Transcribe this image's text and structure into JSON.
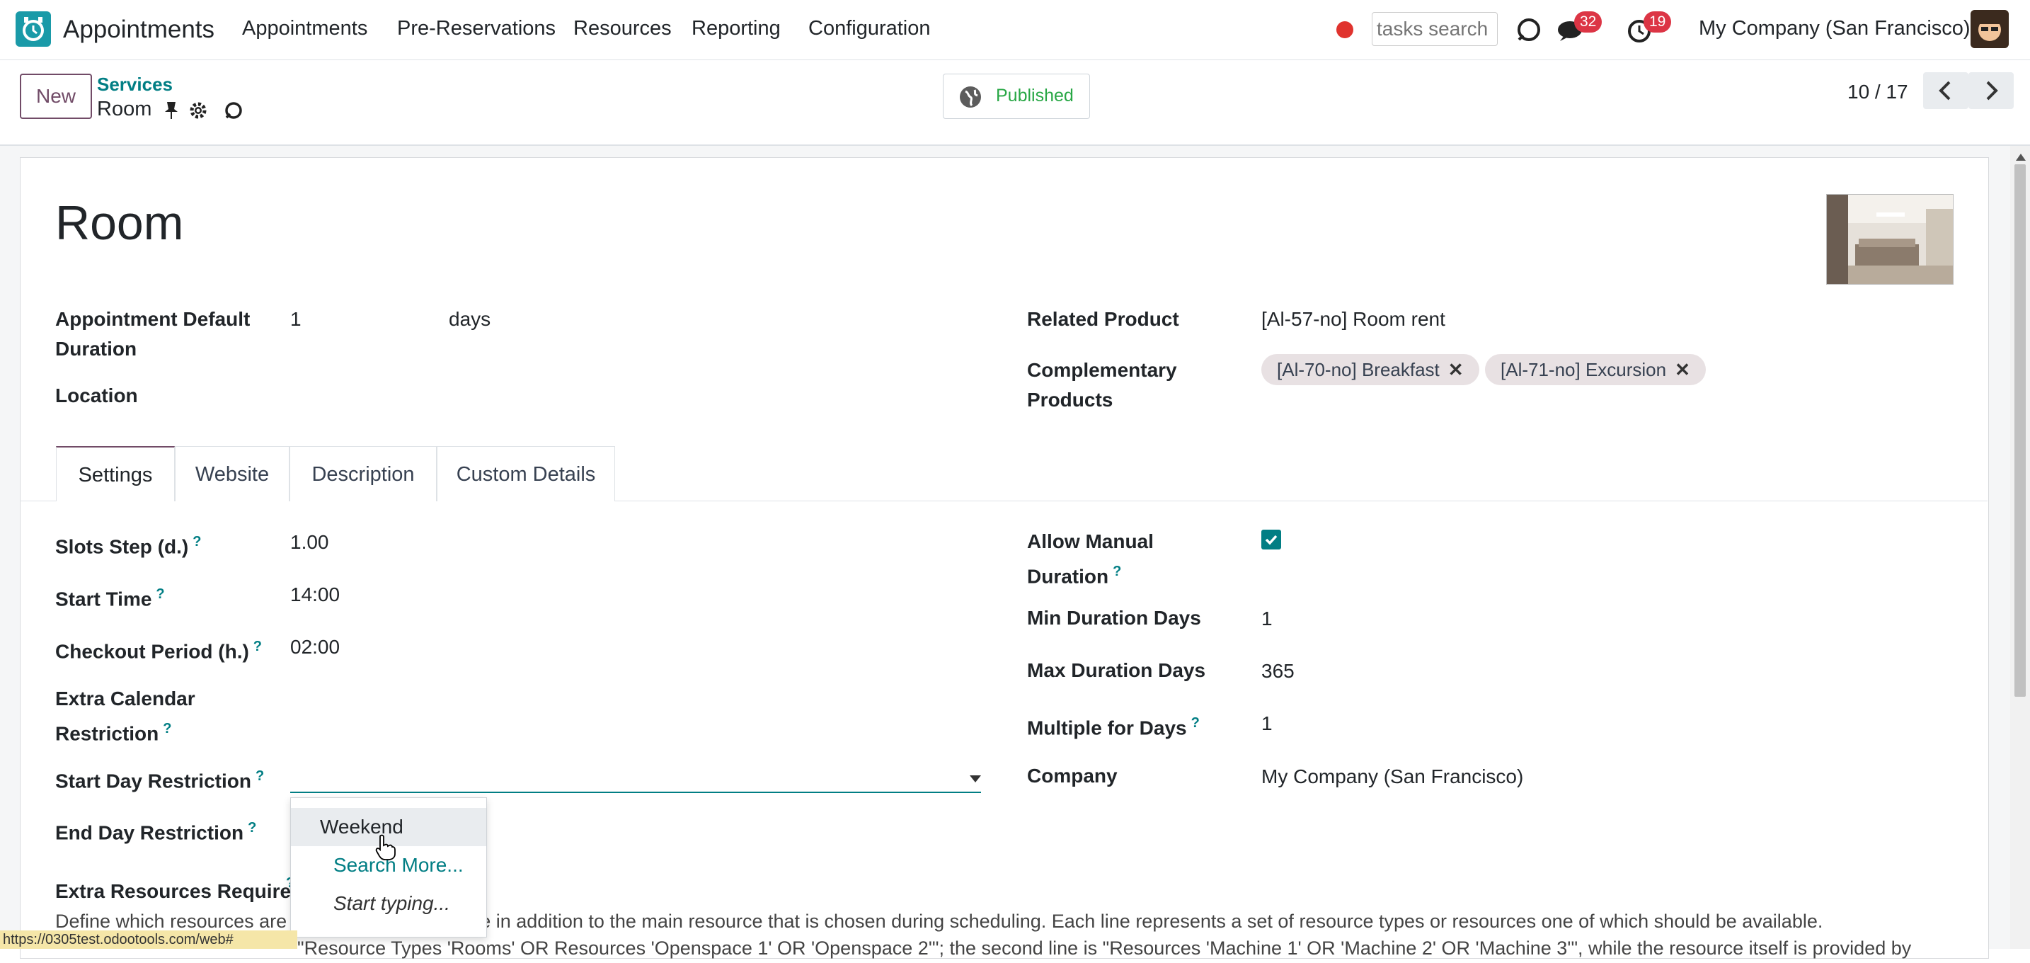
{
  "navbar": {
    "app_title": "Appointments",
    "menu": [
      "Appointments",
      "Pre-Reservations",
      "Resources",
      "Reporting",
      "Configuration"
    ],
    "search_placeholder": "tasks search",
    "messages_count": "32",
    "activities_count": "19",
    "company": "My Company (San Francisco)"
  },
  "control": {
    "new_label": "New",
    "breadcrumb_parent": "Services",
    "breadcrumb_current": "Room",
    "published_label": "Published",
    "pager": "10 / 17"
  },
  "record": {
    "title": "Room",
    "default_duration_label": "Appointment Default Duration",
    "default_duration_value": "1",
    "default_duration_unit": "days",
    "location_label": "Location",
    "related_product_label": "Related Product",
    "related_product_value": "[Al-57-no] Room rent",
    "complementary_label": "Complementary Products",
    "complementary_tags": [
      "[Al-70-no] Breakfast",
      "[Al-71-no] Excursion"
    ]
  },
  "tabs": [
    "Settings",
    "Website",
    "Description",
    "Custom Details"
  ],
  "settings": {
    "slots_step_label": "Slots Step (d.)",
    "slots_step_value": "1.00",
    "start_time_label": "Start Time",
    "start_time_value": "14:00",
    "checkout_label": "Checkout Period (h.)",
    "checkout_value": "02:00",
    "extra_calendar_label": "Extra Calendar Restriction",
    "start_day_label": "Start Day Restriction",
    "end_day_label": "End Day Restriction",
    "allow_manual_label": "Allow Manual Duration",
    "allow_manual_checked": true,
    "min_duration_label": "Min Duration Days",
    "min_duration_value": "1",
    "max_duration_label": "Max Duration Days",
    "max_duration_value": "365",
    "multiple_label": "Multiple for Days",
    "multiple_value": "1",
    "company_label": "Company",
    "company_value": "My Company (San Francisco)",
    "extra_resources_label": "Extra Resources Required",
    "extra_resources_desc": "Define which resources are required for this service in addition to the main resource that is chosen during scheduling. Each line represents a set of resource types or resources one of which should be available.",
    "extra_resources_desc2": "\"Resource Types 'Rooms' OR Resources 'Openspace 1' OR 'Openspace 2'\"; the second line is \"Resources 'Machine 1' OR 'Machine 2' OR 'Machine 3'\", while the resource itself is provided by"
  },
  "dropdown": {
    "items": [
      "Weekend",
      "Search More...",
      "Start typing..."
    ]
  },
  "statusbar": "https://0305test.odootools.com/web#",
  "colors": {
    "brand": "#714b67",
    "accent": "#017e84",
    "badge": "#dc3545"
  }
}
